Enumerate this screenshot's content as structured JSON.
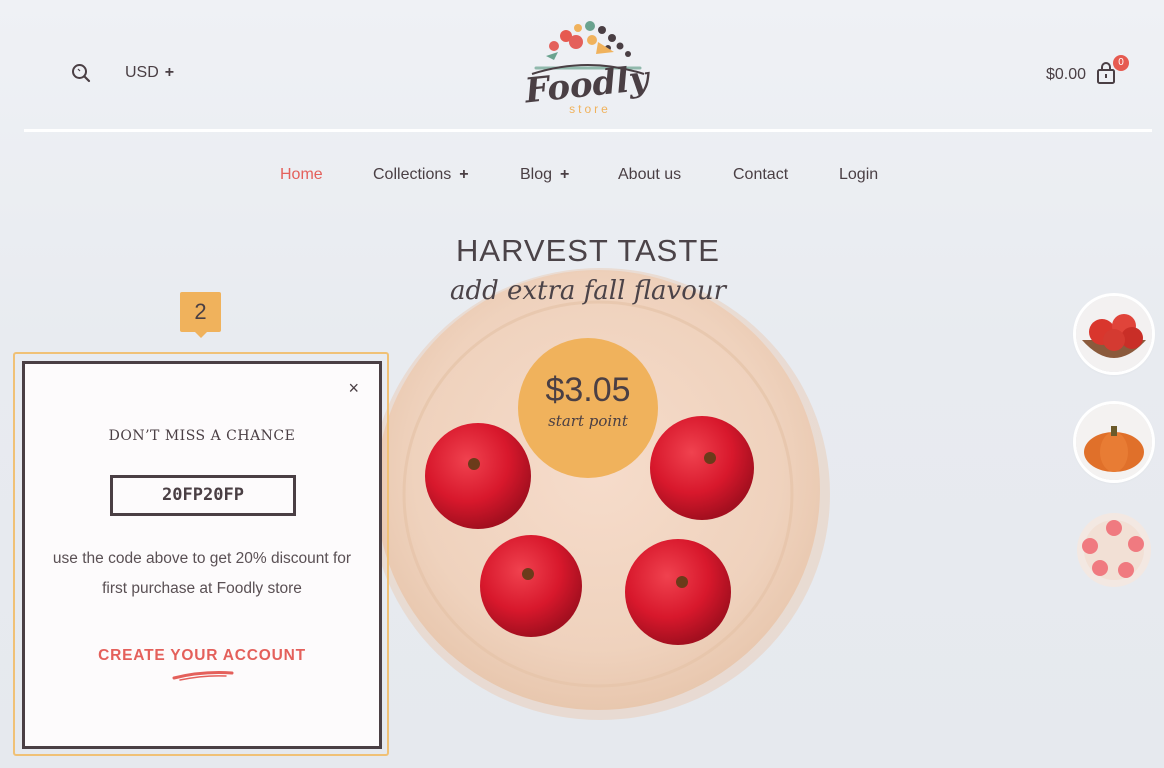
{
  "header": {
    "search_icon": "search-icon",
    "currency": "USD",
    "currency_expand": "+",
    "logo_text": "Foodly",
    "logo_subtext": "store",
    "cart_total": "$0.00",
    "cart_count": "0",
    "cart_icon": "shopping-bag-icon"
  },
  "nav": {
    "items": [
      {
        "label": "Home",
        "active": true,
        "expand": ""
      },
      {
        "label": "Collections",
        "active": false,
        "expand": "+"
      },
      {
        "label": "Blog",
        "active": false,
        "expand": "+"
      },
      {
        "label": "About us",
        "active": false,
        "expand": ""
      },
      {
        "label": "Contact",
        "active": false,
        "expand": ""
      },
      {
        "label": "Login",
        "active": false,
        "expand": ""
      }
    ]
  },
  "hero": {
    "title": "HARVEST TASTE",
    "subtitle": "add extra fall flavour",
    "price": "$3.05",
    "price_note": "start point"
  },
  "thumbnails": [
    "tomatoes-thumbnail",
    "pumpkin-thumbnail",
    "apples-thumbnail"
  ],
  "tour": {
    "step": "2"
  },
  "popup": {
    "close": "×",
    "heading": "DON’T MISS A CHANCE",
    "code": "20FP20FP",
    "text_line1": "use the code above to get 20% discount for",
    "text_line2": "first purchase at Foodly store",
    "cta": "CREATE YOUR ACCOUNT"
  },
  "colors": {
    "accent": "#e4605b",
    "price_circle": "#f0b25c",
    "text_dark": "#4a3f44",
    "background": "#eceef2"
  }
}
